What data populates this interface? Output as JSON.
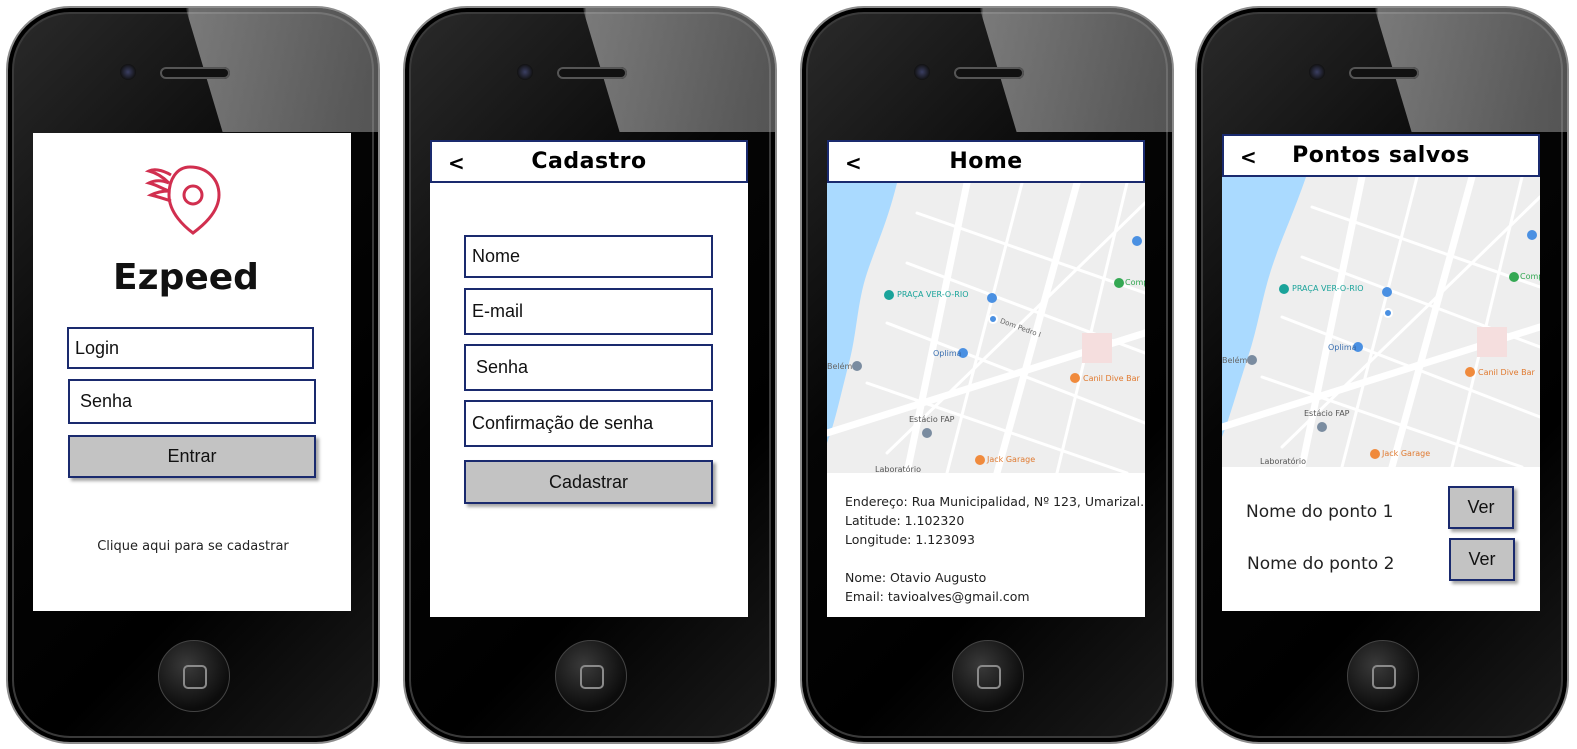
{
  "login": {
    "app_name": "Ezpeed",
    "login_placeholder": "Login",
    "password_placeholder": "Senha",
    "submit_label": "Entrar",
    "signup_link": "Clique aqui para se cadastrar",
    "logo_color": "#d12f4f"
  },
  "cadastro": {
    "back": "<",
    "title": "Cadastro",
    "name_placeholder": "Nome",
    "email_placeholder": "E-mail",
    "password_placeholder": "Senha",
    "confirm_placeholder": "Confirmação de senha",
    "submit_label": "Cadastrar"
  },
  "home": {
    "back": "<",
    "title": "Home",
    "map_labels": {
      "praca": "PRAÇA VER-O-RIO",
      "comp": "Comp",
      "oplima": "Oplima",
      "dom_pedro": "Dom Pedro I",
      "canil": "Canil Dive Bar",
      "belem": "Belém",
      "estacio": "Estácio FAP",
      "jack": "Jack Garage",
      "laboratorio": "Laboratório"
    },
    "info": {
      "address": "Endereço: Rua Municipalidad, Nº 123, Umarizal.",
      "latitude": "Latitude: 1.102320",
      "longitude": "Longitude: 1.123093",
      "name": "Nome: Otavio Augusto",
      "email": "Email: tavioalves@gmail.com"
    }
  },
  "saved": {
    "back": "<",
    "title": "Pontos salvos",
    "points": [
      {
        "name": "Nome do ponto 1",
        "button": "Ver"
      },
      {
        "name": "Nome do ponto 2",
        "button": "Ver"
      }
    ]
  },
  "colors": {
    "navy": "#1a2a6e",
    "button_grey": "#c3c3c3",
    "water": "#aadaff",
    "map_bg": "#eeeeee",
    "road": "#ffffff",
    "poi_orange": "#f08a3c",
    "poi_blue": "#4a90e2",
    "poi_green": "#34a853"
  }
}
